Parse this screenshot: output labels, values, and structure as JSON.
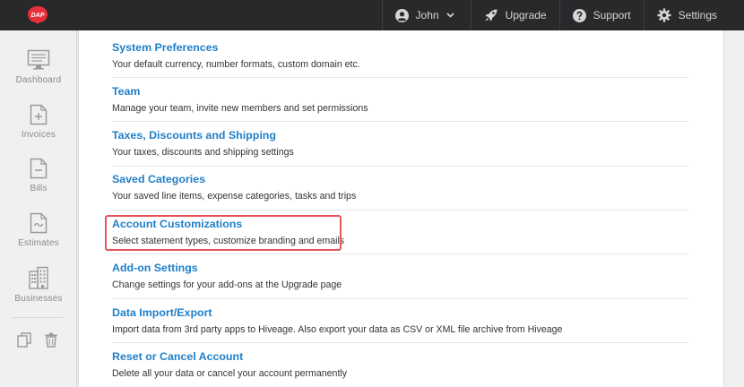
{
  "topbar": {
    "logo_text": "DAP",
    "user_name": "John",
    "upgrade_label": "Upgrade",
    "support_label": "Support",
    "settings_label": "Settings"
  },
  "sidebar": {
    "items": [
      {
        "label": "Dashboard",
        "icon": "monitor-icon"
      },
      {
        "label": "Invoices",
        "icon": "invoice-icon"
      },
      {
        "label": "Bills",
        "icon": "bill-icon"
      },
      {
        "label": "Estimates",
        "icon": "estimate-icon"
      },
      {
        "label": "Businesses",
        "icon": "building-icon"
      }
    ],
    "bottom_icons": [
      "copy-icon",
      "trash-icon"
    ]
  },
  "settings_sections": [
    {
      "title": "System Preferences",
      "description": "Your default currency, number formats, custom domain etc."
    },
    {
      "title": "Team",
      "description": "Manage your team, invite new members and set permissions"
    },
    {
      "title": "Taxes, Discounts and Shipping",
      "description": "Your taxes, discounts and shipping settings"
    },
    {
      "title": "Saved Categories",
      "description": "Your saved line items, expense categories, tasks and trips"
    },
    {
      "title": "Account Customizations",
      "description": "Select statement types, customize branding and emails"
    },
    {
      "title": "Add-on Settings",
      "description": "Change settings for your add-ons at the Upgrade page"
    },
    {
      "title": "Data Import/Export",
      "description": "Import data from 3rd party apps to Hiveage. Also export your data as CSV or XML file archive from Hiveage"
    },
    {
      "title": "Reset or Cancel Account",
      "description": "Delete all your data or cancel your account permanently"
    }
  ],
  "colors": {
    "topbar": "#27292b",
    "link": "#1f7fc9",
    "highlight": "#e8545a"
  }
}
